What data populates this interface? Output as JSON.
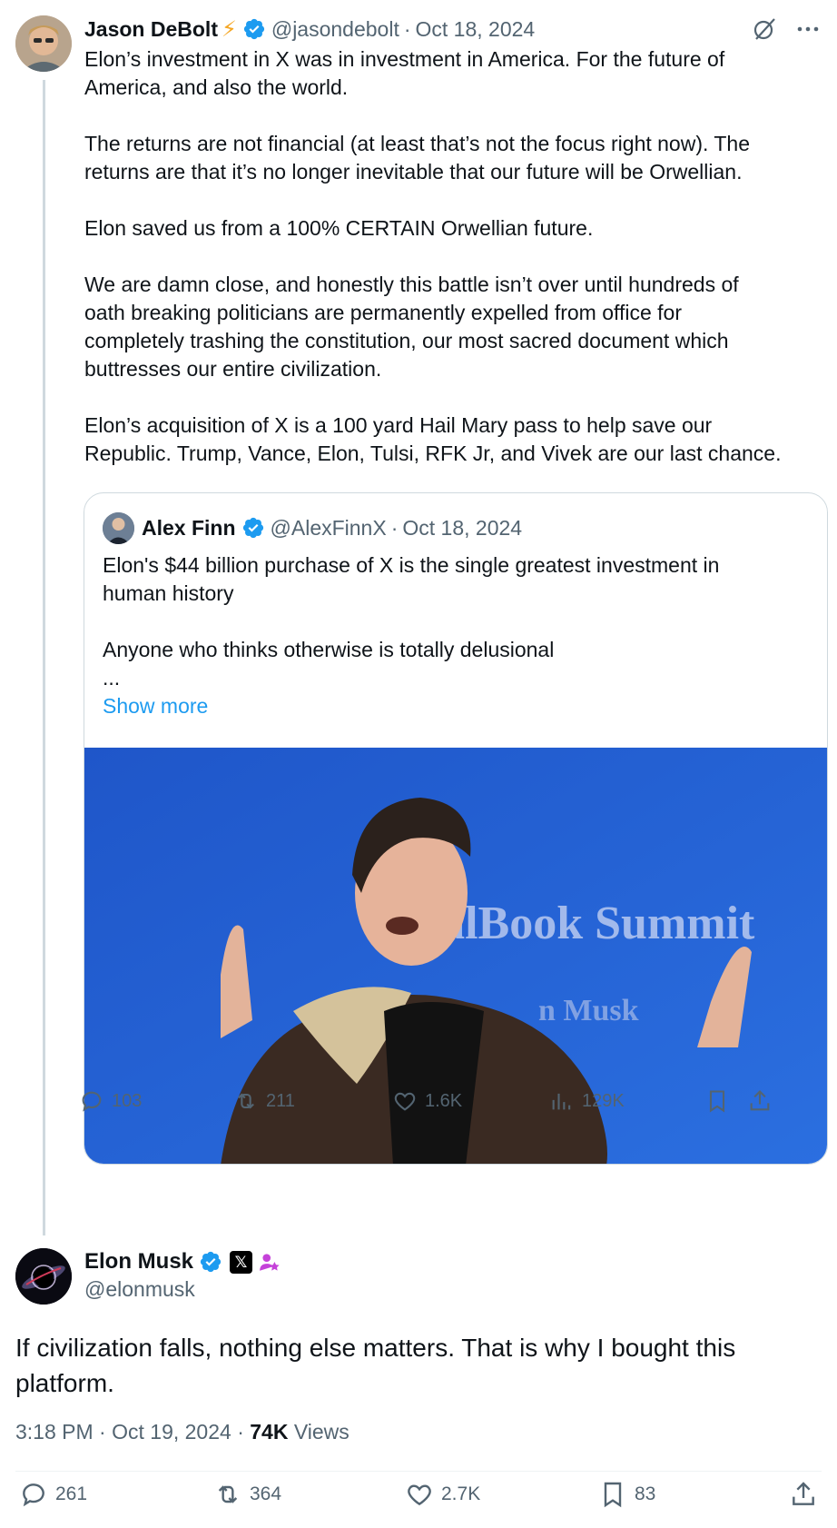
{
  "parent": {
    "name": "Jason DeBolt",
    "name_emoji": "⚡",
    "handle": "@jasondebolt",
    "sep": "·",
    "date": "Oct 18, 2024",
    "text": [
      [
        "Elon’s investment in X was in investment in America. For the future of",
        "America, and also the world."
      ],
      [
        "The returns are not financial (at least that’s not the focus right now). The",
        "returns are that it’s no longer inevitable that our future will be Orwellian."
      ],
      [
        "Elon saved us from a 100% CERTAIN Orwellian future."
      ],
      [
        "We are damn close, and honestly this battle isn’t over until hundreds of",
        "oath breaking politicians are permanently expelled from office for",
        "completely trashing the constitution, our most sacred document which",
        "buttresses our entire civilization."
      ],
      [
        "Elon’s acquisition of X is a 100 yard Hail Mary pass to help save our",
        "Republic. Trump, Vance, Elon, Tulsi, RFK Jr, and Vivek are our last chance."
      ]
    ],
    "quote": {
      "name": "Alex Finn",
      "handle": "@AlexFinnX",
      "sep": "·",
      "date": "Oct 18, 2024",
      "lines": [
        "Elon's $44 billion purchase of X is the single greatest investment in",
        "human history"
      ],
      "line2": "Anyone who thinks otherwise is totally delusional",
      "ellipsis": "...",
      "show_more": "Show more",
      "image_text": "ealBook Summit",
      "image_subtext": "n Musk"
    },
    "stats": {
      "replies": "103",
      "reposts": "211",
      "likes": "1.6K",
      "views": "129K"
    }
  },
  "main": {
    "name": "Elon Musk",
    "x_badge": "𝕏",
    "handle": "@elonmusk",
    "text": [
      "If civilization falls, nothing else matters. That is why I bought this",
      "platform."
    ],
    "time": "3:18 PM",
    "sep": "·",
    "date": "Oct 19, 2024",
    "sep2": "·",
    "views_count": "74K",
    "views_label": "Views",
    "stats": {
      "replies": "261",
      "reposts": "364",
      "likes": "2.7K",
      "bookmarks": "83"
    }
  },
  "colors": {
    "accent": "#1d9bf0",
    "text": "#0f1419",
    "secondary": "#536471",
    "border": "#cfd9de"
  },
  "icons": [
    "verified-icon",
    "grok-icon",
    "more-icon",
    "reply-icon",
    "repost-icon",
    "like-icon",
    "views-icon",
    "bookmark-icon",
    "share-icon",
    "affiliate-icon"
  ]
}
